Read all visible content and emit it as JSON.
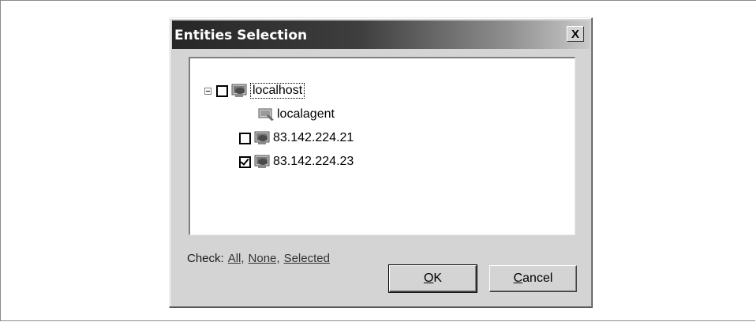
{
  "dialog": {
    "title": "Entities Selection",
    "close_label": "X"
  },
  "tree": {
    "root": {
      "label": "localhost",
      "checked": false,
      "expanded": true,
      "icon": "host-icon"
    },
    "children": [
      {
        "label": "localagent",
        "icon": "agent-icon",
        "has_checkbox": false
      },
      {
        "label": "83.142.224.21",
        "icon": "host-icon",
        "has_checkbox": true,
        "checked": false
      },
      {
        "label": "83.142.224.23",
        "icon": "host-icon",
        "has_checkbox": true,
        "checked": true
      }
    ]
  },
  "check_links": {
    "prefix": "Check:",
    "all": "All,",
    "none": "None,",
    "selected": "Selected"
  },
  "buttons": {
    "ok": {
      "mnemonic": "O",
      "rest": "K"
    },
    "cancel": {
      "mnemonic": "C",
      "rest": "ancel"
    }
  }
}
